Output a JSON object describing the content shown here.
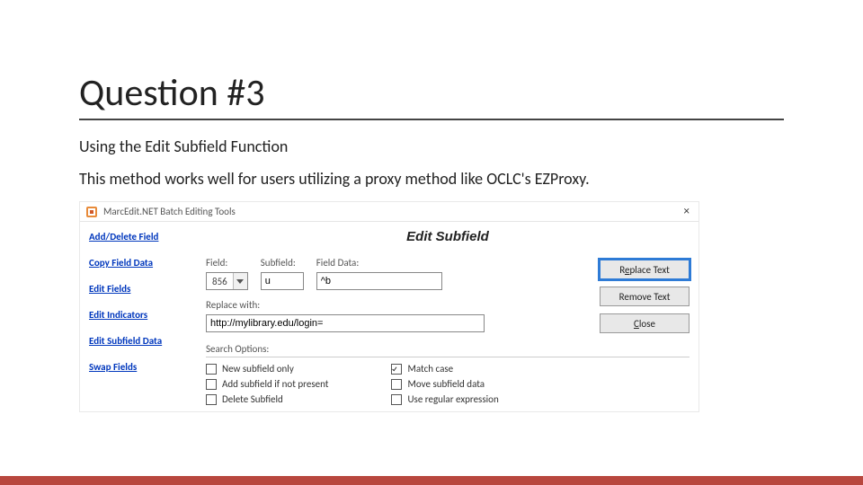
{
  "heading": "Question #3",
  "subtitle_line1": "Using the Edit Subfield Function",
  "subtitle_line2": "This method works well for users utilizing a proxy method like OCLC's EZProxy.",
  "window": {
    "title": "MarcEdit.NET Batch Editing Tools",
    "close_icon": "×"
  },
  "sidebar": {
    "items": [
      {
        "label": "Add/Delete Field"
      },
      {
        "label": "Copy Field Data"
      },
      {
        "label": "Edit Fields"
      },
      {
        "label": "Edit Indicators"
      },
      {
        "label": "Edit Subfield Data"
      },
      {
        "label": "Swap Fields"
      }
    ]
  },
  "panel": {
    "title": "Edit Subfield",
    "field_label": "Field:",
    "subfield_label": "Subfield:",
    "fielddata_label": "Field Data:",
    "field_value": "856",
    "subfield_value": "u",
    "fielddata_value": "^b",
    "replace_label": "Replace with:",
    "replace_value": "http://mylibrary.edu/login=",
    "options_label": "Search Options:",
    "options_left": [
      {
        "label": "New subfield only",
        "checked": false
      },
      {
        "label": "Add subfield if not present",
        "checked": false
      },
      {
        "label": "Delete Subfield",
        "checked": false
      }
    ],
    "options_right": [
      {
        "label": "Match case",
        "checked": true
      },
      {
        "label": "Move subfield data",
        "checked": false
      },
      {
        "label": "Use regular expression",
        "checked": false
      }
    ]
  },
  "buttons": {
    "replace_pre": "R",
    "replace_u": "e",
    "replace_post": "place Text",
    "remove": "Remove Text",
    "close_pre": "",
    "close_u": "C",
    "close_post": "lose"
  }
}
